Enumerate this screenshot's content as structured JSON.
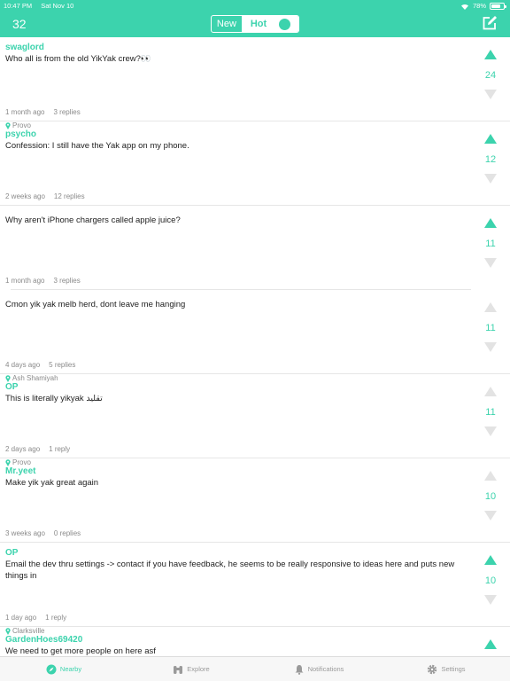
{
  "status_bar": {
    "time": "10:47 PM",
    "date": "Sat Nov 10",
    "battery": "78%",
    "battery_level": 0.78
  },
  "header": {
    "score": "32",
    "tabs": [
      {
        "label": "New"
      },
      {
        "label": "Hot"
      }
    ],
    "active_tab": "Hot",
    "accent_color": "#3cd3ad"
  },
  "posts": [
    {
      "location": "",
      "handle": "swaglord",
      "text": "Who all is from the old YikYak crew?👀",
      "age": "1 month ago",
      "replies": "3 replies",
      "votes": "24",
      "upvote_active": true
    },
    {
      "location": "Provo",
      "handle": "psycho",
      "text": "Confession: I still have the Yak app on my phone.",
      "age": "2 weeks ago",
      "replies": "12 replies",
      "votes": "12",
      "upvote_active": true
    },
    {
      "location": "",
      "handle": "",
      "text": "Why aren't iPhone chargers called apple juice?",
      "age": "1 month ago",
      "replies": "3 replies",
      "votes": "11",
      "upvote_active": true
    },
    {
      "location": "",
      "handle": "",
      "text": "Cmon yik yak melb herd, dont leave me hanging",
      "age": "4 days ago",
      "replies": "5 replies",
      "votes": "11",
      "upvote_active": false
    },
    {
      "location": "Ash Shamiyah",
      "handle": "OP",
      "text": "This is literally yikyak تقليد",
      "age": "2 days ago",
      "replies": "1 reply",
      "votes": "11",
      "upvote_active": false
    },
    {
      "location": "Provo",
      "handle": "Mr.yeet",
      "text": "Make yik yak great again",
      "age": "3 weeks ago",
      "replies": "0 replies",
      "votes": "10",
      "upvote_active": false
    },
    {
      "location": "",
      "handle": "OP",
      "text": "Email the dev thru settings -> contact if you have feedback, he seems to be really responsive to ideas here and puts new things in",
      "age": "1 day ago",
      "replies": "1 reply",
      "votes": "10",
      "upvote_active": true
    },
    {
      "location": "Clarksville",
      "handle": "GardenHoes69420",
      "text": "We need to get more people on here asf",
      "age": "",
      "replies": "",
      "votes": "",
      "upvote_active": true
    }
  ],
  "tabbar": {
    "items": [
      {
        "label": "Nearby",
        "icon": "compass-icon",
        "active": true
      },
      {
        "label": "Explore",
        "icon": "binoculars-icon",
        "active": false
      },
      {
        "label": "Notifications",
        "icon": "bell-icon",
        "active": false
      },
      {
        "label": "Settings",
        "icon": "gear-icon",
        "active": false
      }
    ]
  }
}
